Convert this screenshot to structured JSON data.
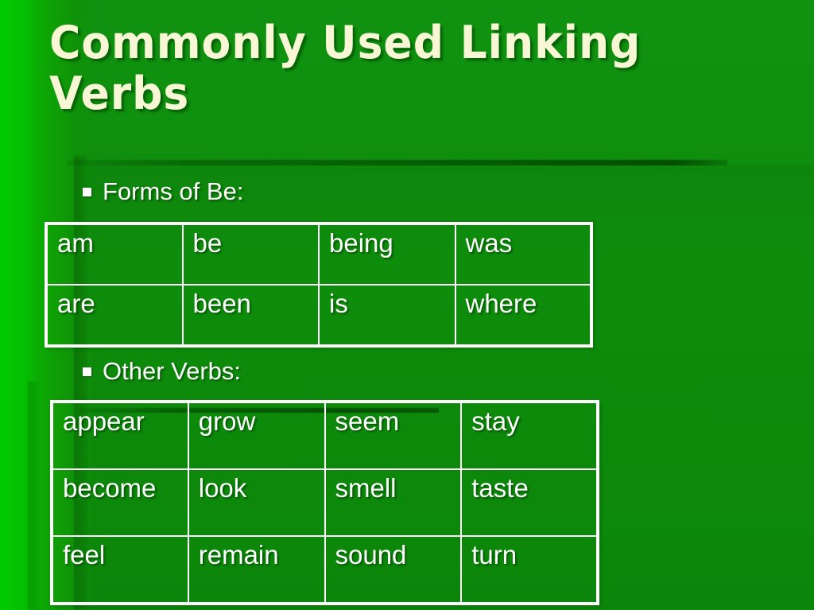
{
  "slide": {
    "title": "Commonly Used Linking Verbs",
    "background_color": "#0f8c0c",
    "title_color": "#f7f7d6",
    "text_color": "#ffffff",
    "accent_color": "#00c400"
  },
  "sections": [
    {
      "bullet_label": "Forms of Be:",
      "bullet_glyph": "square-bullet",
      "table": {
        "columns": 4,
        "rows": [
          [
            "am",
            "be",
            "being",
            "was"
          ],
          [
            "are",
            "been",
            "is",
            "where"
          ]
        ]
      }
    },
    {
      "bullet_label": "Other Verbs:",
      "bullet_glyph": "square-bullet",
      "table": {
        "columns": 4,
        "rows": [
          [
            "appear",
            "grow",
            "seem",
            "stay"
          ],
          [
            "become",
            "look",
            "smell",
            "taste"
          ],
          [
            "feel",
            "remain",
            "sound",
            "turn"
          ]
        ]
      }
    }
  ]
}
